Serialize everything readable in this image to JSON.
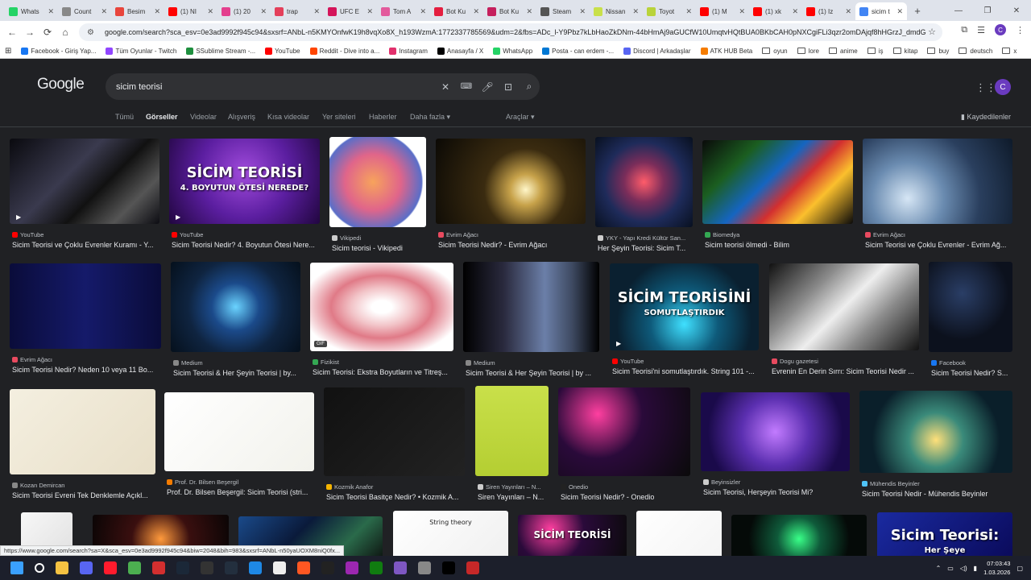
{
  "browser": {
    "tabs": [
      {
        "title": "Whats",
        "color": "#25d366"
      },
      {
        "title": "Count",
        "color": "#888888"
      },
      {
        "title": "Besim",
        "color": "#e8453c"
      },
      {
        "title": "(1) NI",
        "color": "#ff0000"
      },
      {
        "title": "(1) 20",
        "color": "#e43f8e"
      },
      {
        "title": "trap",
        "color": "#e43f5a"
      },
      {
        "title": "UFC E",
        "color": "#d4145a"
      },
      {
        "title": "Tom A",
        "color": "#e35a9c"
      },
      {
        "title": "Bot Ku",
        "color": "#e41e3f"
      },
      {
        "title": "Bot Ku",
        "color": "#c51f5d"
      },
      {
        "title": "Steam",
        "color": "#555555"
      },
      {
        "title": "Nissan",
        "color": "#c9e04a"
      },
      {
        "title": "Toyot",
        "color": "#b9d33a"
      },
      {
        "title": "(1) M",
        "color": "#ff0000"
      },
      {
        "title": "(1) xk",
        "color": "#ff0000"
      },
      {
        "title": "(1) Iz",
        "color": "#ff0000"
      },
      {
        "title": "sicim t",
        "color": "#4285f4",
        "active": true
      }
    ],
    "new_tab": "+",
    "window_controls": [
      "—",
      "❐",
      "✕"
    ],
    "url": "google.com/search?sca_esv=0e3ad9992f945c94&sxsrf=ANbL-n5KMYOnfwK19h8vqXo8X_h193WzmA:1772337785569&udm=2&fbs=ADc_l-Y9Pbz7kLbHaoZkDNm-44bHmAj9aGUCfW10UmqtvHQtBUA0BKbCAH0pNXCgiFLi3qzr2omDAjqf8hHGrzJ_dmdGeQLUH-F7F...",
    "profile_initial": "C"
  },
  "bookmarks": [
    {
      "label": "Facebook - Giriş Yap...",
      "color": "#1877f2",
      "type": "site"
    },
    {
      "label": "Tüm Oyunlar - Twitch",
      "color": "#9146ff",
      "type": "site"
    },
    {
      "label": "SSublime Stream -...",
      "color": "#1e8f3e",
      "type": "site"
    },
    {
      "label": "YouTube",
      "color": "#ff0000",
      "type": "site"
    },
    {
      "label": "Reddit - Dive into a...",
      "color": "#ff4500",
      "type": "site"
    },
    {
      "label": "Instagram",
      "color": "#e1306c",
      "type": "site"
    },
    {
      "label": "Anasayfa / X",
      "color": "#000000",
      "type": "site"
    },
    {
      "label": "WhatsApp",
      "color": "#25d366",
      "type": "site"
    },
    {
      "label": "Posta - can erdem -...",
      "color": "#0078d4",
      "type": "site"
    },
    {
      "label": "Discord | Arkadaşlar",
      "color": "#5865f2",
      "type": "site"
    },
    {
      "label": "ATK HUB Beta",
      "color": "#f57c00",
      "type": "site"
    },
    {
      "label": "oyun",
      "type": "folder"
    },
    {
      "label": "lore",
      "type": "folder"
    },
    {
      "label": "anime",
      "type": "folder"
    },
    {
      "label": "iş",
      "type": "folder"
    },
    {
      "label": "kitap",
      "type": "folder"
    },
    {
      "label": "buy",
      "type": "folder"
    },
    {
      "label": "deutsch",
      "type": "folder"
    },
    {
      "label": "x",
      "type": "folder"
    }
  ],
  "google": {
    "logo": "Google",
    "query": "sicim teorisi",
    "avatar_initial": "C",
    "tabs": [
      "Tümü",
      "Görseller",
      "Videolar",
      "Alışveriş",
      "Kısa videolar",
      "Yer siteleri",
      "Haberler",
      "Daha fazla"
    ],
    "active_tab": "Görseller",
    "tools": "Araçlar",
    "saved": "Kaydedilenler"
  },
  "results": [
    {
      "source": "YouTube",
      "title": "Sicim Teorisi ve Çoklu Evrenler Kuramı - Y...",
      "bg": "linear-gradient(135deg,#0a0a0f,#3a3a4e 40%,#111 60%,#555 80%,#0c0c12)",
      "dot": "#ff0000",
      "play": true
    },
    {
      "source": "YouTube",
      "title": "Sicim Teorisi Nedir? 4. Boyutun Ötesi Nere...",
      "bg": "radial-gradient(circle at 50% 40%,#a14bdc,#5b1ea0 50%,#21063f)",
      "dot": "#ff0000",
      "play": true,
      "overlay": "SİCİM TEORİSİ",
      "overlay2": "4. BOYUTUN ÖTESİ NEREDE?"
    },
    {
      "source": "Vikipedi",
      "title": "Sicim teorisi - Vikipedi",
      "bg": "radial-gradient(circle at 45% 50%,#f7a35c,#e0658a 40%,#5a6ec8 70%,#ffffff 72%)",
      "dot": "#cccccc"
    },
    {
      "source": "Evrim Ağacı",
      "title": "Sicim Teorisi Nedir? - Evrim Ağacı",
      "bg": "radial-gradient(circle at 60% 60%,#fff6c8,#c7a24a 15%,#3a2b10 40%,#0b0905)",
      "dot": "#e84a5f"
    },
    {
      "source": "YKY - Yapı Kredi Kültür San...",
      "title": "Her Şeyin Teorisi: Sicim T...",
      "bg": "radial-gradient(circle at 50% 50%,#ff5c6a,#7a2d5a 30%,#1e2b5a 60%,#08101f)",
      "dot": "#cccccc"
    },
    {
      "source": "Biomedya",
      "title": "Sicim teorisi ölmedi - Bilim",
      "bg": "linear-gradient(135deg,#0a0a0a,#1b5e20 25%,#1565c0 45%,#d32f2f 60%,#fbc02d 75%,#0a0a0a)",
      "dot": "#34a853"
    },
    {
      "source": "Evrim Ağacı",
      "title": "Sicim Teorisi ve Çoklu Evrenler - Evrim Ağ...",
      "bg": "radial-gradient(circle at 30% 70%,#d6e6f5,#6a8bb0 30%,#2a3f5e 60%,#0e1a2a)",
      "dot": "#e84a5f"
    },
    {
      "source": "Evrim Ağacı",
      "title": "Sicim Teorisi Nedir? Neden 10 veya 11 Bo...",
      "bg": "linear-gradient(90deg,#0a0c3a,#151a6a 50%,#0a0c3a)",
      "dot": "#e84a5f"
    },
    {
      "source": "Medium",
      "title": "Sicim Teorisi & Her Şeyin Teorisi | by...",
      "bg": "radial-gradient(circle at 50% 50%,#6ad3ff,#1b4a8a 30%,#0f2440 60%,#05101c)",
      "dot": "#888888"
    },
    {
      "source": "Fizikist",
      "title": "Sicim Teorisi: Ekstra Boyutların ve Titreş...",
      "bg": "radial-gradient(ellipse at 50% 50%,#ffffff 10%,#f2c4c8 30%,#e07a87 50%,#ffffff 80%)",
      "dot": "#34a853",
      "gif": true
    },
    {
      "source": "Medium",
      "title": "Sicim Teorisi & Her Şeyin Teorisi | by ...",
      "bg": "linear-gradient(90deg,#000,#2a2a3e 30%,#6b7fa8 60%,#3e4a62 80%,#000)",
      "dot": "#888888"
    },
    {
      "source": "YouTube",
      "title": "Sicim Teorisi'ni somutlaştırdık. String 101 -...",
      "bg": "radial-gradient(circle at 50% 70%,#3fe0ff,#0e5a7a 35%,#0a2030 70%)",
      "dot": "#ff0000",
      "play": true,
      "overlay": "SİCİM TEORİSİNİ",
      "overlay2": "SOMUTLAŞTIRDIK"
    },
    {
      "source": "Dogu gazetesi",
      "title": "Evrenin En Derin Sırrı: Sicim Teorisi Nedir ...",
      "bg": "linear-gradient(135deg,#111,#8a8a8a 30%,#eeeeee 50%,#8a8a8a 70%,#111)",
      "dot": "#e84a5f"
    },
    {
      "source": "Facebook",
      "title": "Sicim Teorisi Nedir? S...",
      "bg": "radial-gradient(circle at 40% 35%,#2a3e66,#0c111d 60%)",
      "dot": "#1877f2"
    },
    {
      "source": "Kozan Demircan",
      "title": "Sicim Teorisi Evreni Tek Denklemle Açıkl...",
      "bg": "linear-gradient(135deg,#f4efe0,#e8dfc8)",
      "dot": "#888888"
    },
    {
      "source": "Prof. Dr. Bilsen Beşergil",
      "title": "Prof. Dr. Bilsen Beşergil: Sicim Teorisi (stri...",
      "bg": "linear-gradient(135deg,#ffffff,#f2f2ec)",
      "dot": "#f57c00"
    },
    {
      "source": "Kozmik Anafor",
      "title": "Sicim Teorisi Basitçe Nedir? • Kozmik A...",
      "bg": "linear-gradient(135deg,#111,#222)",
      "dot": "#f5b400"
    },
    {
      "source": "Siren Yayınları – N...",
      "title": "Siren Yayınları – N...",
      "bg": "linear-gradient(180deg,#c9e04a,#b4ce32)",
      "dot": "#cccccc"
    },
    {
      "source": "Onedio",
      "title": "Sicim Teorisi Nedir? - Onedio",
      "bg": "radial-gradient(circle at 30% 30%,#ff3fa0,#2a0a3a 40%,#0a0a0a)",
      "dot": "#222222"
    },
    {
      "source": "Beyinsizler",
      "title": "Sicim Teorisi, Herşeyin Teorisi Mi?",
      "bg": "radial-gradient(circle at 50% 50%,#c27bff,#5b2fb0 40%,#1a0a4a 80%)",
      "dot": "#cccccc"
    },
    {
      "source": "Mühendis Beyinler",
      "title": "Sicim Teorisi Nedir - Mühendis Beyinler",
      "bg": "radial-gradient(circle at 50% 60%,#ffe07a,#3a8a7a 30%,#0a1f2a 70%)",
      "dot": "#4fc3f7"
    },
    {
      "source": "",
      "title": "",
      "bg": "linear-gradient(135deg,#f7f7f7,#e0e0e0)",
      "dot": ""
    },
    {
      "source": "",
      "title": "",
      "bg": "radial-gradient(circle at 50% 50%,#ff9a3c,#3a0f0f 40%,#0a0505)",
      "dot": ""
    },
    {
      "source": "",
      "title": "",
      "bg": "linear-gradient(135deg,#1a4a8a,#0a1a3a 40%,#2a6a4a 70%,#0a0a0a)",
      "dot": ""
    },
    {
      "source": "",
      "title": "",
      "bg": "linear-gradient(135deg,#ffffff,#f0f0f0)",
      "dot": "",
      "overlay_dark": "String theory"
    },
    {
      "source": "",
      "title": "",
      "bg": "radial-gradient(circle at 30% 30%,#ff3fa0,#2a0a3a 40%,#0a0a0a)",
      "dot": "",
      "overlay": "SİCİM TEORİSİ"
    },
    {
      "source": "",
      "title": "",
      "bg": "linear-gradient(135deg,#ffffff,#f4f4f4)",
      "dot": ""
    },
    {
      "source": "",
      "title": "",
      "bg": "radial-gradient(circle at 50% 50%,#39ff88,#0f5a3a 30%,#050a08 70%)",
      "dot": ""
    },
    {
      "source": "",
      "title": "",
      "bg": "linear-gradient(135deg,#1a2aa0,#0a0a5a)",
      "dot": "",
      "overlay": "Sicim Teorisi:",
      "overlay2": "Her Şeye"
    }
  ],
  "status_url": "https://www.google.com/search?sa=X&sca_esv=0e3ad9992f945c94&biw=2048&bih=983&sxsrf=ANbL-n50yaUOXM8niQ0fx...",
  "taskbar": {
    "icons": [
      {
        "name": "windows-start-icon",
        "color": "#3aa0ff"
      },
      {
        "name": "search-icon",
        "color": "#ffffff"
      },
      {
        "name": "file-explorer-icon",
        "color": "#f5c242"
      },
      {
        "name": "discord-icon",
        "color": "#5865f2"
      },
      {
        "name": "opera-icon",
        "color": "#ff1b2d"
      },
      {
        "name": "chrome-icon",
        "color": "#4caf50"
      },
      {
        "name": "app-red-icon",
        "color": "#d32f2f"
      },
      {
        "name": "steam-icon",
        "color": "#1b2838"
      },
      {
        "name": "epic-games-icon",
        "color": "#333333"
      },
      {
        "name": "amazon-icon",
        "color": "#232f3e"
      },
      {
        "name": "app-blue-icon",
        "color": "#1e88e5"
      },
      {
        "name": "app-circle-icon",
        "color": "#eeeeee"
      },
      {
        "name": "app-orange-icon",
        "color": "#ff5722"
      },
      {
        "name": "app-dark-icon",
        "color": "#222222"
      },
      {
        "name": "app-purple-icon",
        "color": "#9c27b0"
      },
      {
        "name": "xbox-icon",
        "color": "#107c10"
      },
      {
        "name": "app-violet-icon",
        "color": "#7e57c2"
      },
      {
        "name": "app-gray-icon",
        "color": "#888888"
      },
      {
        "name": "app-black-icon",
        "color": "#000000"
      },
      {
        "name": "app-shield-icon",
        "color": "#c62828"
      }
    ],
    "time": "07:03:43",
    "date": "1.03.2026"
  }
}
